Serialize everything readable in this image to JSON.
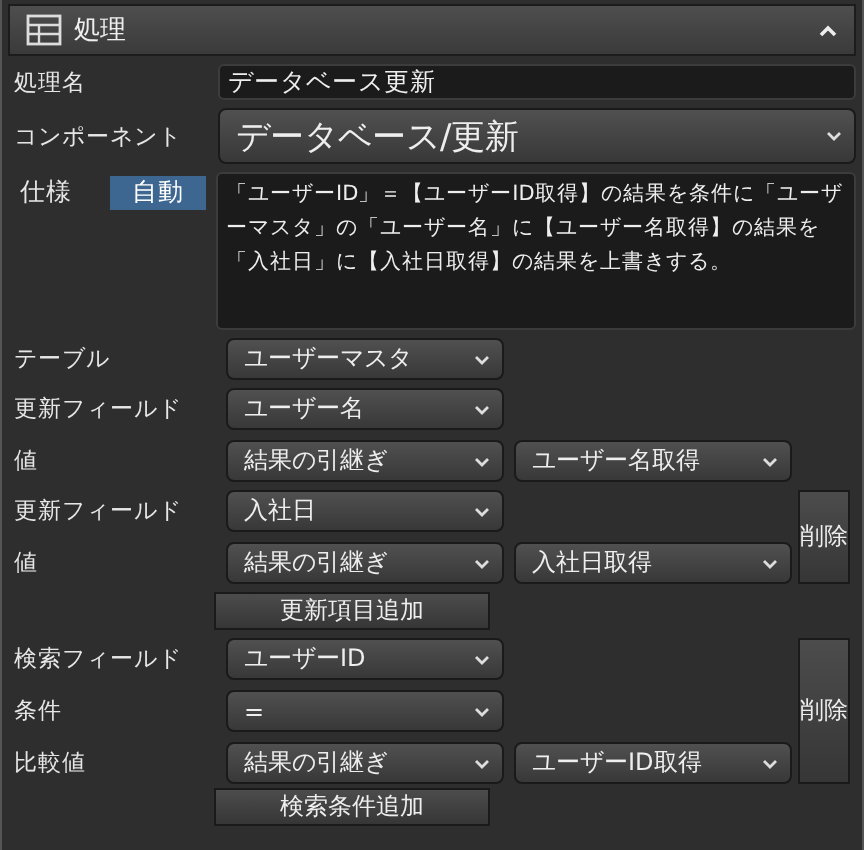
{
  "panel": {
    "title": "処理",
    "expanded": true
  },
  "name": {
    "label": "処理名",
    "value": "データベース更新"
  },
  "component": {
    "label": "コンポーネント",
    "value": "データベース/更新"
  },
  "spec": {
    "label": "仕様",
    "mode": "自動",
    "text": "「ユーザーID」＝【ユーザーID取得】の結果を条件に「ユーザーマスタ」の「ユーザー名」に【ユーザー名取得】の結果を「入社日」に【入社日取得】の結果を上書きする。"
  },
  "table": {
    "label": "テーブル",
    "value": "ユーザーマスタ"
  },
  "update_items": [
    {
      "field_label": "更新フィールド",
      "field": "ユーザー名",
      "value_label": "値",
      "source": "結果の引継ぎ",
      "ref": "ユーザー名取得",
      "deletable": false
    },
    {
      "field_label": "更新フィールド",
      "field": "入社日",
      "value_label": "値",
      "source": "結果の引継ぎ",
      "ref": "入社日取得",
      "deletable": true,
      "delete_label": "削除"
    }
  ],
  "add_update_button": "更新項目追加",
  "search_conditions": [
    {
      "field_label": "検索フィールド",
      "field": "ユーザーID",
      "condition_label": "条件",
      "condition": "=",
      "value_label": "比較値",
      "source": "結果の引継ぎ",
      "ref": "ユーザーID取得",
      "deletable": true,
      "delete_label": "削除"
    }
  ],
  "add_search_button": "検索条件追加"
}
